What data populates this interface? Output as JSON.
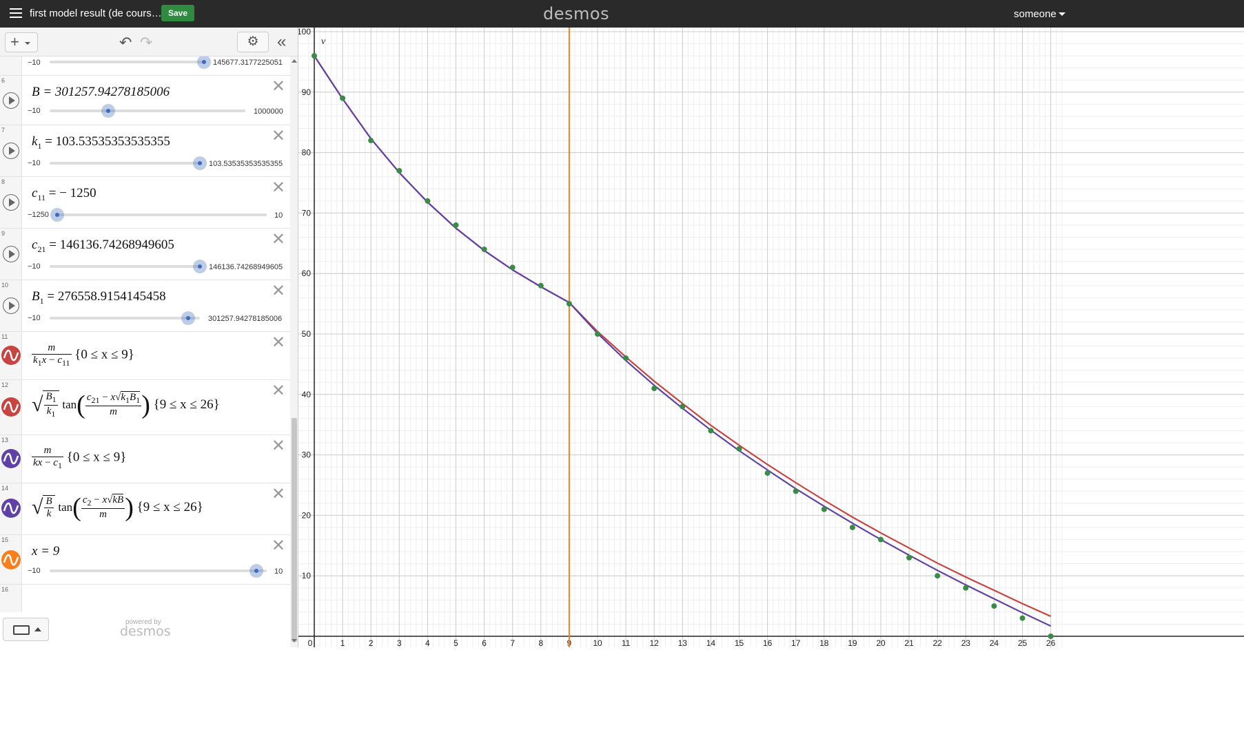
{
  "header": {
    "title": "first model result (de cours…",
    "save_label": "Save",
    "logo": "desmos",
    "user": "someone"
  },
  "toolbar": {
    "add_label": "+",
    "undo": "↶",
    "redo": "↷",
    "settings": "⚙",
    "collapse": "«"
  },
  "expressions": [
    {
      "num": "",
      "slider_min": "−10",
      "slider_max": "145677.3177225051",
      "fraction": 0.985
    },
    {
      "num": "6",
      "latex": "B = 301257.94278185006",
      "slider_min": "−10",
      "slider_max": "1000000",
      "fraction": 0.3013
    },
    {
      "num": "7",
      "var": "k",
      "sub": "1",
      "value": "= 103.53535353535355",
      "slider_min": "−10",
      "slider_max": "103.53535353535355",
      "fraction": 1.0
    },
    {
      "num": "8",
      "var": "c",
      "sub": "11",
      "value": "= − 1250",
      "slider_min": "−1250",
      "slider_max": "10",
      "fraction": 0.0
    },
    {
      "num": "9",
      "var": "c",
      "sub": "21",
      "value": "= 146136.74268949605",
      "slider_min": "−10",
      "slider_max": "146136.74268949605",
      "fraction": 1.0
    },
    {
      "num": "10",
      "var": "B",
      "sub": "1",
      "value": "= 276558.9154145458",
      "slider_min": "−10",
      "slider_max": "301257.94278185006",
      "fraction": 0.918
    },
    {
      "num": "11",
      "domain": "{0 ≤ x ≤ 9}",
      "color": "#c74440"
    },
    {
      "num": "12",
      "domain": "{9 ≤ x ≤ 26}",
      "color": "#c74440"
    },
    {
      "num": "13",
      "domain": "{0 ≤ x ≤ 9}",
      "color": "#6042a6"
    },
    {
      "num": "14",
      "domain": "{9 ≤ x ≤ 26}",
      "color": "#6042a6"
    },
    {
      "num": "15",
      "latex": "x = 9",
      "slider_min": "−10",
      "slider_max": "10",
      "fraction": 0.95,
      "color": "#fa7e19"
    },
    {
      "num": "16"
    }
  ],
  "footer": {
    "powered_by": "powered by",
    "logo": "desmos"
  },
  "chart_data": {
    "type": "scatter",
    "xlabel": "",
    "ylabel": "v",
    "xlim": [
      -0.2,
      26.5
    ],
    "ylim": [
      0,
      100
    ],
    "x_major_ticks": [
      0,
      1,
      2,
      3,
      4,
      5,
      6,
      7,
      8,
      9,
      10,
      11,
      12,
      13,
      14,
      15,
      16,
      17,
      18,
      19,
      20,
      21,
      22,
      23,
      24,
      25,
      26
    ],
    "y_major_ticks": [
      10,
      20,
      30,
      40,
      50,
      60,
      70,
      80,
      90,
      100
    ],
    "grid": true,
    "vertical_line": {
      "x": 9,
      "color": "#fa7e19"
    },
    "series": [
      {
        "values_x": [
          0,
          1,
          2,
          3,
          4,
          5,
          6,
          7,
          8,
          9,
          10,
          11,
          12,
          13,
          14,
          15,
          16,
          17,
          18,
          19,
          20,
          21,
          22,
          23,
          24,
          25,
          26
        ],
        "values_y": [
          96,
          89,
          82,
          77,
          72,
          68,
          64,
          61,
          58,
          55,
          50,
          46,
          41,
          38,
          34,
          31,
          27,
          24,
          21,
          18,
          16,
          13,
          10,
          8,
          5,
          3,
          0
        ],
        "color": "#388c46"
      }
    ],
    "curves": [
      {
        "color": "#c74440",
        "x": [
          0,
          1,
          2,
          3,
          4,
          5,
          6,
          7,
          8,
          9,
          10,
          11,
          12,
          13,
          14,
          15,
          16,
          17,
          18,
          19,
          20,
          21,
          22,
          23,
          24,
          25,
          26
        ],
        "y": [
          96,
          88.9,
          82.3,
          76.7,
          71.8,
          67.5,
          63.8,
          60.6,
          57.8,
          55.2,
          50.4,
          46.2,
          42.2,
          38.5,
          34.9,
          31.6,
          28.4,
          25.4,
          22.5,
          19.7,
          17.1,
          14.6,
          12.1,
          9.8,
          7.6,
          5.4,
          3.3
        ]
      },
      {
        "color": "#6042a6",
        "x": [
          0,
          1,
          2,
          3,
          4,
          5,
          6,
          7,
          8,
          9,
          10,
          11,
          12,
          13,
          14,
          15,
          16,
          17,
          18,
          19,
          20,
          21,
          22,
          23,
          24,
          25,
          26
        ],
        "y": [
          96,
          88.9,
          82.3,
          76.7,
          71.8,
          67.5,
          63.8,
          60.6,
          57.8,
          55.2,
          50.1,
          45.6,
          41.5,
          37.7,
          34.1,
          30.7,
          27.5,
          24.4,
          21.5,
          18.7,
          16.0,
          13.4,
          10.9,
          8.5,
          6.2,
          3.9,
          1.7
        ]
      }
    ]
  }
}
